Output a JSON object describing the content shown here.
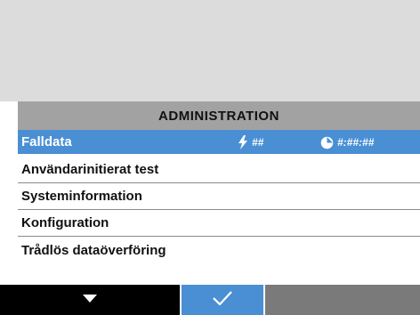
{
  "menu": {
    "title": "ADMINISTRATION",
    "selected": {
      "label": "Falldata",
      "shock_count": "##",
      "time": "#:##:##"
    },
    "items": [
      {
        "label": "Användarinitierat test"
      },
      {
        "label": "Systeminformation"
      },
      {
        "label": "Konfiguration"
      },
      {
        "label": "Trådlös dataöverföring"
      }
    ]
  },
  "softkeys": [
    {
      "icon": "down-arrow-icon",
      "color": "#000000"
    },
    {
      "icon": "checkmark-icon",
      "color": "#4a8fd4"
    },
    {
      "icon": "",
      "color": "#7a7a7a"
    }
  ],
  "colors": {
    "header_bg": "#a2a2a2",
    "selected_bg": "#4a8fd4",
    "top_area_bg": "#dcdcdc"
  }
}
